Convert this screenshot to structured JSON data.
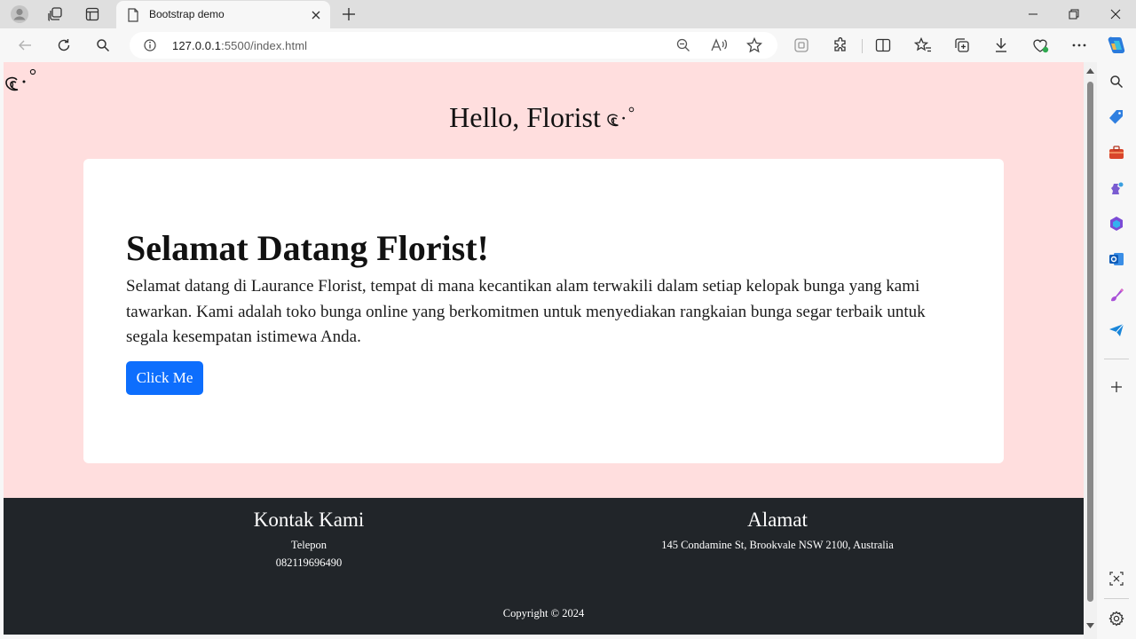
{
  "browser": {
    "tab": {
      "title": "Bootstrap demo"
    },
    "address": {
      "host": "127.0.0.1",
      "path": ":5500/index.html"
    }
  },
  "page": {
    "header": {
      "title": "Hello, Florist"
    },
    "jumbotron": {
      "heading": "Selamat Datang Florist!",
      "text": "Selamat datang di Laurance Florist, tempat di mana kecantikan alam terwakili dalam setiap kelopak bunga yang kami tawarkan. Kami adalah toko bunga online yang berkomitmen untuk menyediakan rangkaian bunga segar terbaik untuk segala kesempatan istimewa Anda.",
      "button_label": "Click Me"
    },
    "footer": {
      "contact": {
        "title": "Kontak Kami",
        "phone_label": "Telepon",
        "phone": "082119696490"
      },
      "address": {
        "title": "Alamat",
        "value": "145 Condamine St, Brookvale NSW 2100, Australia"
      },
      "copyright": "Copyright © 2024"
    }
  },
  "colors": {
    "page_background": "#ffdede",
    "card_background": "#ffffff",
    "button_primary": "#0d6efd",
    "footer_background": "#212529"
  },
  "icons": {
    "tabbar": [
      "profile-icon",
      "workspaces-icon",
      "tab-actions-icon",
      "page-favicon",
      "close-icon",
      "new-tab-icon",
      "minimize-icon",
      "restore-icon",
      "window-close-icon"
    ],
    "toolbar": [
      "back-icon",
      "refresh-icon",
      "search-icon",
      "info-icon",
      "zoom-out-icon",
      "read-aloud-icon",
      "favorite-star-icon",
      "app-icon",
      "extensions-icon",
      "split-screen-icon",
      "favorites-icon",
      "collections-icon",
      "downloads-icon",
      "browser-essentials-icon",
      "more-icon",
      "copilot-icon"
    ],
    "sidebar": [
      "search-icon",
      "shopping-tag-icon",
      "tools-briefcase-icon",
      "games-icon",
      "microsoft-365-icon",
      "outlook-icon",
      "designer-icon",
      "send-icon",
      "add-icon",
      "screenshot-icon",
      "settings-icon"
    ],
    "page": [
      "flower-doodle-icon"
    ]
  }
}
